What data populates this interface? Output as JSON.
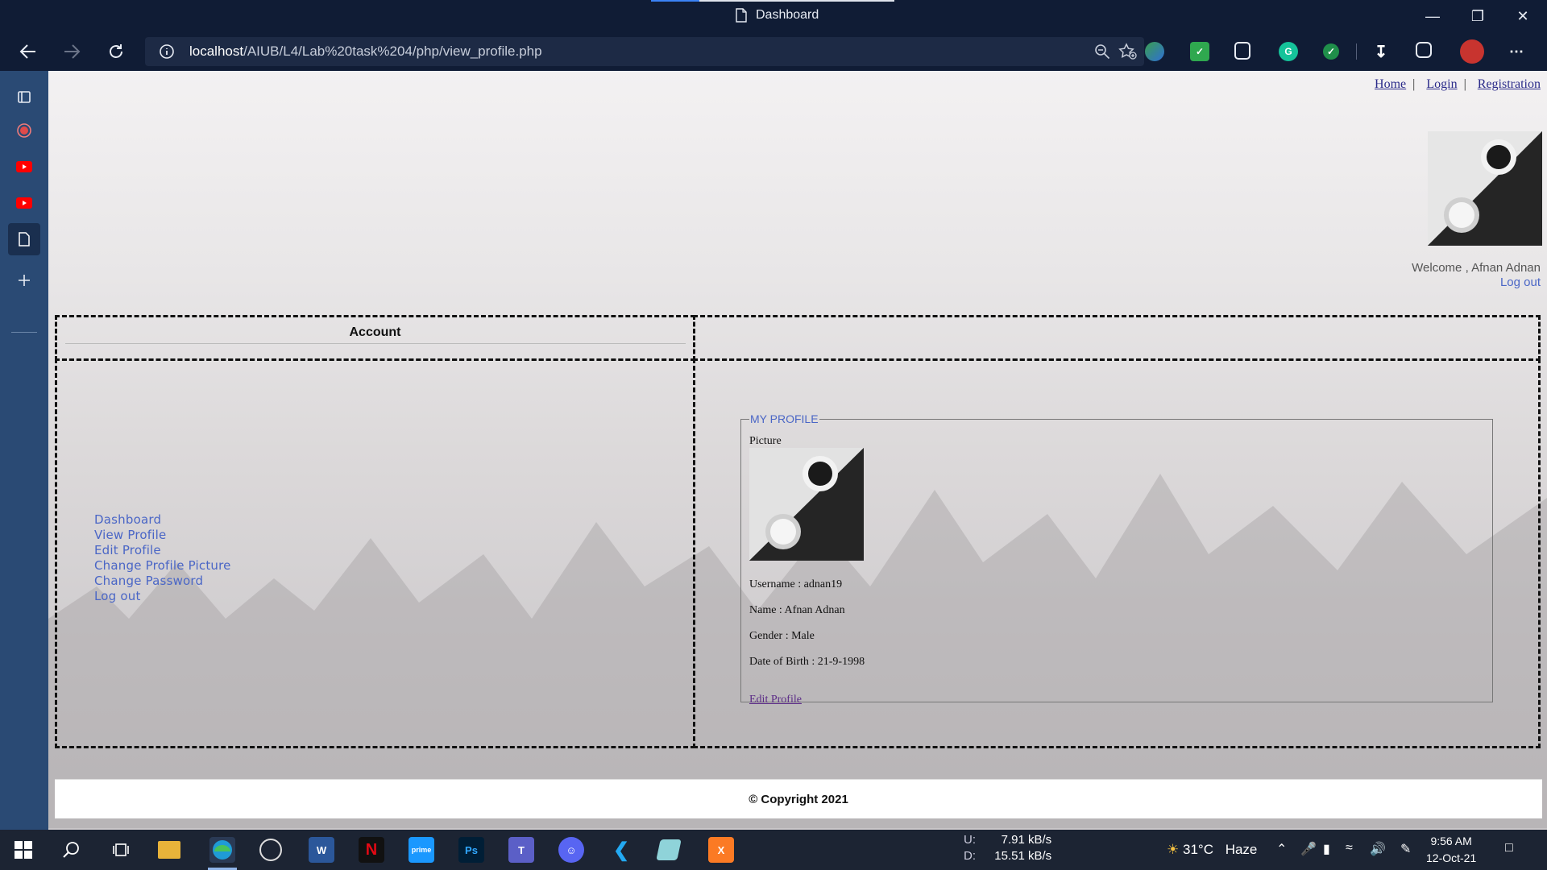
{
  "window": {
    "title": "Dashboard"
  },
  "browser": {
    "url_host": "localhost",
    "url_path": "/AIUB/L4/Lab%20task%204/php/view_profile.php"
  },
  "header": {
    "links": [
      "Home",
      "Login",
      "Registration"
    ],
    "separator": "|",
    "welcome_text": "Welcome , Afnan Adnan",
    "logout_label": "Log out"
  },
  "account": {
    "title": "Account"
  },
  "menu": {
    "items": [
      "Dashboard",
      "View Profile",
      "Edit Profile",
      "Change Profile Picture",
      "Change Password",
      "Log out"
    ]
  },
  "profile": {
    "legend": "MY PROFILE",
    "picture_label": "Picture",
    "username": "Username : adnan19",
    "name": "Name : Afnan Adnan",
    "gender": "Gender : Male",
    "dob": "Date of Birth : 21-9-1998",
    "edit_link": "Edit Profile"
  },
  "footer": {
    "text": "© Copyright 2021"
  },
  "taskbar": {
    "net_upload_label": "U:",
    "net_upload": "7.91 kB/s",
    "net_download_label": "D:",
    "net_download": "15.51 kB/s",
    "weather_temp": "31°C",
    "weather_desc": "Haze",
    "time": "9:56 AM",
    "date": "12-Oct-21"
  },
  "colors": {
    "accent_link": "#4a66c6",
    "browser_chrome": "#101c35",
    "sidebar": "#2a4a74"
  }
}
